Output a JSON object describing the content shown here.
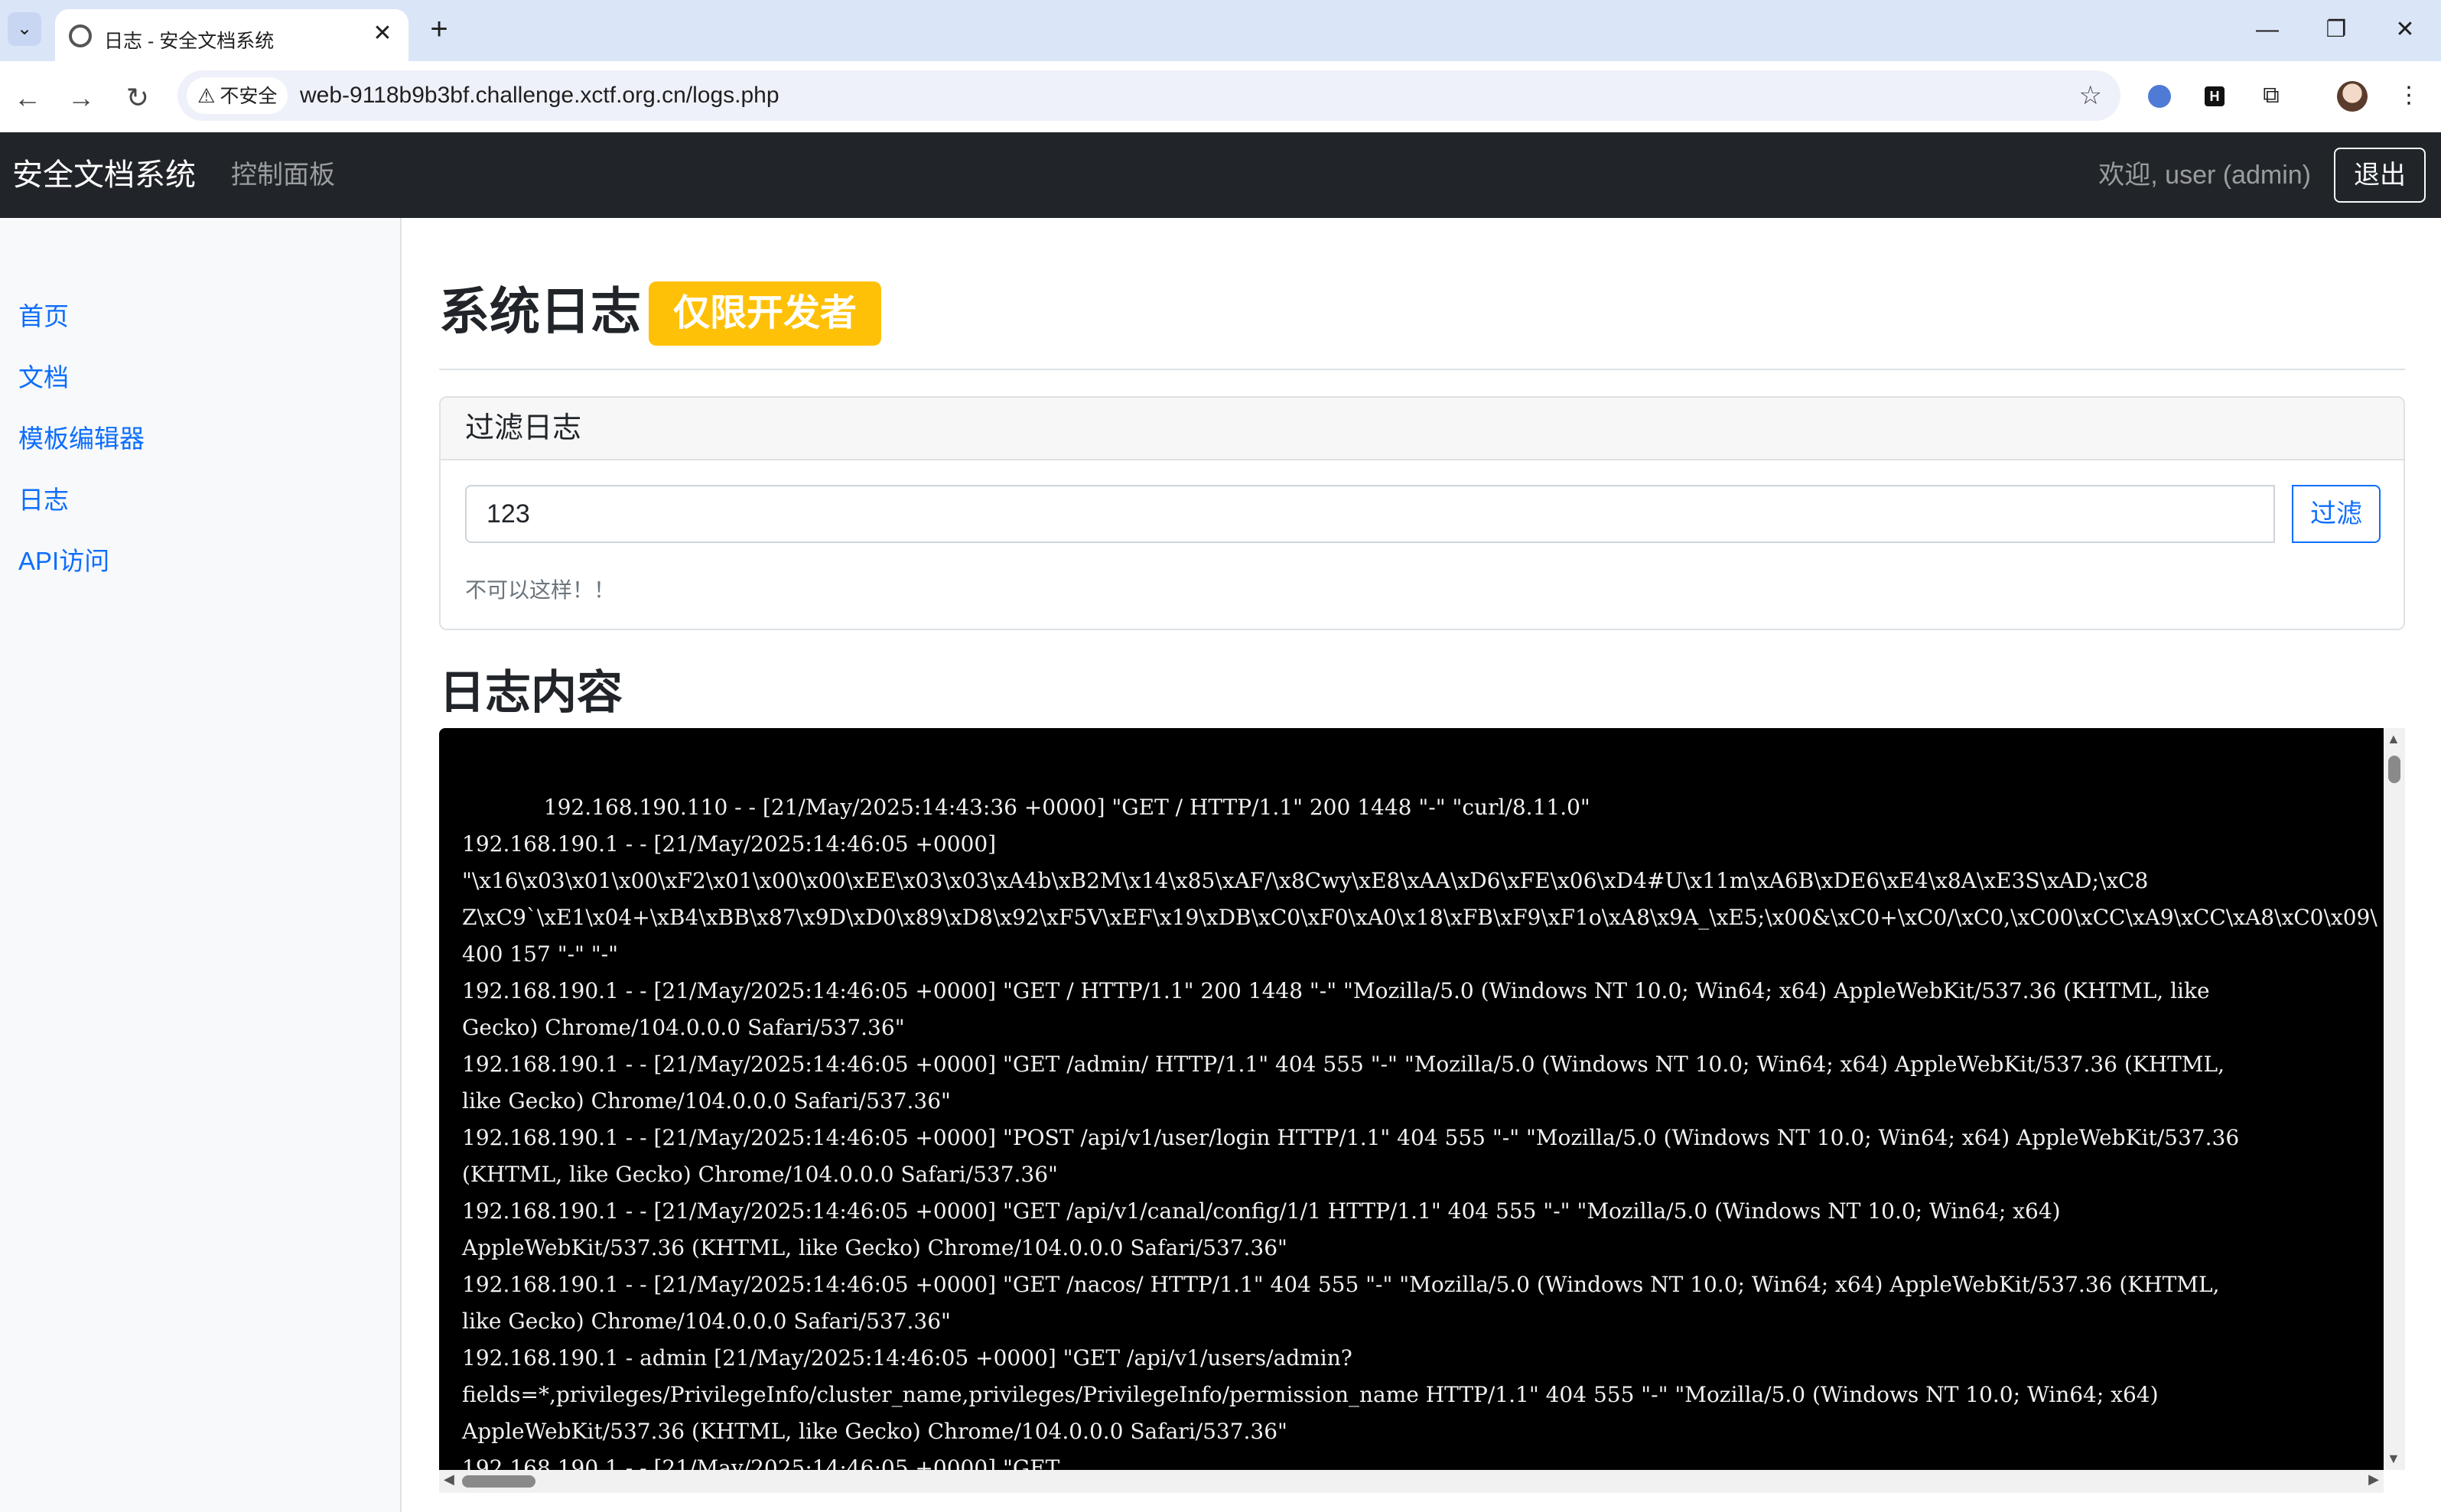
{
  "browser": {
    "tab_title": "日志 - 安全文档系统",
    "new_tab": "+",
    "close": "✕",
    "insecure_label": "不安全",
    "url": "web-9118b9b3bf.challenge.xctf.org.cn/logs.php",
    "ext_h_label": "H"
  },
  "navbar": {
    "brand": "安全文档系统",
    "dashboard": "控制面板",
    "welcome": "欢迎, user (admin)",
    "logout": "退出"
  },
  "sidebar": {
    "items": [
      {
        "label": "首页"
      },
      {
        "label": "文档"
      },
      {
        "label": "模板编辑器"
      },
      {
        "label": "日志"
      },
      {
        "label": "API访问"
      }
    ]
  },
  "main": {
    "title": "系统日志",
    "badge": "仅限开发者",
    "filter": {
      "header": "过滤日志",
      "value": "123",
      "button": "过滤",
      "message": "不可以这样！！"
    },
    "log_title": "日志内容",
    "log_text": "            192.168.190.110 - - [21/May/2025:14:43:36 +0000] \"GET / HTTP/1.1\" 200 1448 \"-\" \"curl/8.11.0\"\n192.168.190.1 - - [21/May/2025:14:46:05 +0000]\n\"\\x16\\x03\\x01\\x00\\xF2\\x01\\x00\\x00\\xEE\\x03\\x03\\xA4b\\xB2M\\x14\\x85\\xAF/\\x8Cwy\\xE8\\xAA\\xD6\\xFE\\x06\\xD4#U\\x11m\\xA6B\\xDE6\\xE4\\x8A\\xE3S\\xAD;\\xC8\nZ\\xC9`\\xE1\\x04+\\xB4\\xBB\\x87\\x9D\\xD0\\x89\\xD8\\x92\\xF5V\\xEF\\x19\\xDB\\xC0\\xF0\\xA0\\x18\\xFB\\xF9\\xF1o\\xA8\\x9A_\\xE5;\\x00&\\xC0+\\xC0/\\xC0,\\xC00\\xCC\\xA9\\xCC\\xA8\\xC0\\x09\\\n400 157 \"-\" \"-\"\n192.168.190.1 - - [21/May/2025:14:46:05 +0000] \"GET / HTTP/1.1\" 200 1448 \"-\" \"Mozilla/5.0 (Windows NT 10.0; Win64; x64) AppleWebKit/537.36 (KHTML, like\nGecko) Chrome/104.0.0.0 Safari/537.36\"\n192.168.190.1 - - [21/May/2025:14:46:05 +0000] \"GET /admin/ HTTP/1.1\" 404 555 \"-\" \"Mozilla/5.0 (Windows NT 10.0; Win64; x64) AppleWebKit/537.36 (KHTML,\nlike Gecko) Chrome/104.0.0.0 Safari/537.36\"\n192.168.190.1 - - [21/May/2025:14:46:05 +0000] \"POST /api/v1/user/login HTTP/1.1\" 404 555 \"-\" \"Mozilla/5.0 (Windows NT 10.0; Win64; x64) AppleWebKit/537.36\n(KHTML, like Gecko) Chrome/104.0.0.0 Safari/537.36\"\n192.168.190.1 - - [21/May/2025:14:46:05 +0000] \"GET /api/v1/canal/config/1/1 HTTP/1.1\" 404 555 \"-\" \"Mozilla/5.0 (Windows NT 10.0; Win64; x64)\nAppleWebKit/537.36 (KHTML, like Gecko) Chrome/104.0.0.0 Safari/537.36\"\n192.168.190.1 - - [21/May/2025:14:46:05 +0000] \"GET /nacos/ HTTP/1.1\" 404 555 \"-\" \"Mozilla/5.0 (Windows NT 10.0; Win64; x64) AppleWebKit/537.36 (KHTML,\nlike Gecko) Chrome/104.0.0.0 Safari/537.36\"\n192.168.190.1 - admin [21/May/2025:14:46:05 +0000] \"GET /api/v1/users/admin?\nfields=*,privileges/PrivilegeInfo/cluster_name,privileges/PrivilegeInfo/permission_name HTTP/1.1\" 404 555 \"-\" \"Mozilla/5.0 (Windows NT 10.0; Win64; x64)\nAppleWebKit/537.36 (KHTML, like Gecko) Chrome/104.0.0.0 Safari/537.36\"\n192.168.190.1 - - [21/May/2025:14:46:05 +0000] \"GET"
  }
}
